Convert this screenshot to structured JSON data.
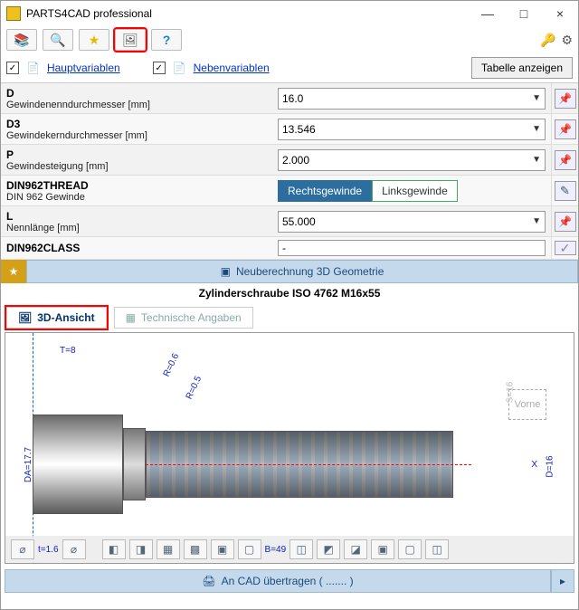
{
  "app": {
    "title": "PARTS4CAD professional"
  },
  "window": {
    "minimize": "—",
    "maximize": "□",
    "close": "×"
  },
  "toolbar": {
    "books_tip": "📚",
    "search_tip": "🔍",
    "star_tip": "★",
    "view_tip": "🖼",
    "help_tip": "?",
    "key_tip": "🔑",
    "gear_tip": "⚙"
  },
  "vars": {
    "haupt_check": "✓",
    "haupt_label": "Hauptvariablen",
    "neben_check": "✓",
    "neben_label": "Nebenvariablen",
    "show_table": "Tabelle anzeigen"
  },
  "params": [
    {
      "code": "D",
      "desc": "Gewindenenndurchmesser [mm]",
      "value": "16.0",
      "action": "pin"
    },
    {
      "code": "D3",
      "desc": "Gewindekerndurchmesser [mm]",
      "value": "13.546",
      "action": "pin"
    },
    {
      "code": "P",
      "desc": "Gewindesteigung [mm]",
      "value": "2.000",
      "action": "pin"
    },
    {
      "code": "DIN962THREAD",
      "desc": "DIN 962 Gewinde",
      "value": "",
      "action": "edit",
      "options": {
        "left": "Rechtsgewinde",
        "right": "Linksgewinde"
      }
    },
    {
      "code": "L",
      "desc": "Nennlänge [mm]",
      "value": "55.000",
      "action": "pin"
    },
    {
      "code": "DIN962CLASS",
      "desc": "",
      "value": "-",
      "action": "check"
    }
  ],
  "recalc": {
    "label": "Neuberechnung 3D Geometrie"
  },
  "part": {
    "title": "Zylinderschraube ISO 4762 M16x55"
  },
  "tabs": {
    "view3d": "3D-Ansicht",
    "tech": "Technische Angaben"
  },
  "drawing": {
    "dim_T": "T=8",
    "dim_DA": "DA=17.7",
    "dim_R1": "R=0.6",
    "dim_R2": "R=0.5",
    "dim_X": "X",
    "dim_D": "D=16",
    "dim_S": "S=16",
    "dim_t": "t=1.6",
    "dim_B": "B=49",
    "vorne": "Vorne"
  },
  "export": {
    "label": "An CAD übertragen ( ....... )",
    "arrow": "▸"
  }
}
